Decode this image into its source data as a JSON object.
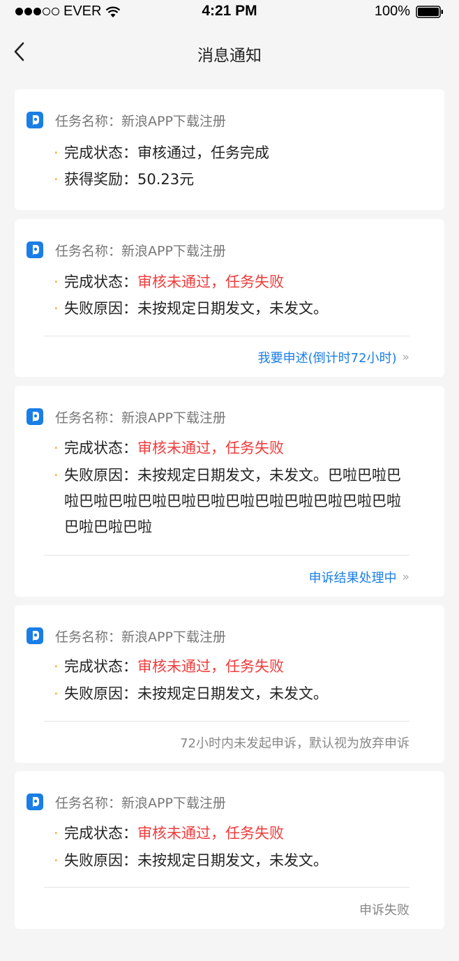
{
  "status_bar": {
    "carrier": "EVER",
    "time": "4:21 PM",
    "battery": "100%"
  },
  "nav": {
    "title": "消息通知"
  },
  "colors": {
    "accent_blue": "#1a7ee6",
    "failure_red": "#f03c3c",
    "bullet_orange": "#f5a623"
  },
  "cards": [
    {
      "task_name": "任务名称：新浪APP下载注册",
      "status_label": "完成状态：",
      "status_value": "审核通过，任务完成",
      "detail_label": "获得奖励：",
      "detail_value": "50.23元"
    },
    {
      "task_name": "任务名称：新浪APP下载注册",
      "status_label": "完成状态：",
      "status_value": "审核未通过，任务失败",
      "detail_label": "失败原因：",
      "detail_value": "未按规定日期发文，未发文。",
      "footer": "我要申述(倒计时72小时)"
    },
    {
      "task_name": "任务名称：新浪APP下载注册",
      "status_label": "完成状态：",
      "status_value": "审核未通过，任务失败",
      "detail_label": "失败原因：",
      "detail_value": "未按规定日期发文，未发文。巴啦巴啦巴啦巴啦巴啦巴啦巴啦巴啦巴啦巴啦巴啦巴啦巴啦巴啦巴啦巴啦巴啦",
      "footer": "申诉结果处理中"
    },
    {
      "task_name": "任务名称：新浪APP下载注册",
      "status_label": "完成状态：",
      "status_value": "审核未通过，任务失败",
      "detail_label": "失败原因：",
      "detail_value": "未按规定日期发文，未发文。",
      "footer": "72小时内未发起申诉，默认视为放弃申诉"
    },
    {
      "task_name": "任务名称：新浪APP下载注册",
      "status_label": "完成状态：",
      "status_value": "审核未通过，任务失败",
      "detail_label": "失败原因：",
      "detail_value": "未按规定日期发文，未发文。",
      "footer": "申诉失败"
    }
  ]
}
